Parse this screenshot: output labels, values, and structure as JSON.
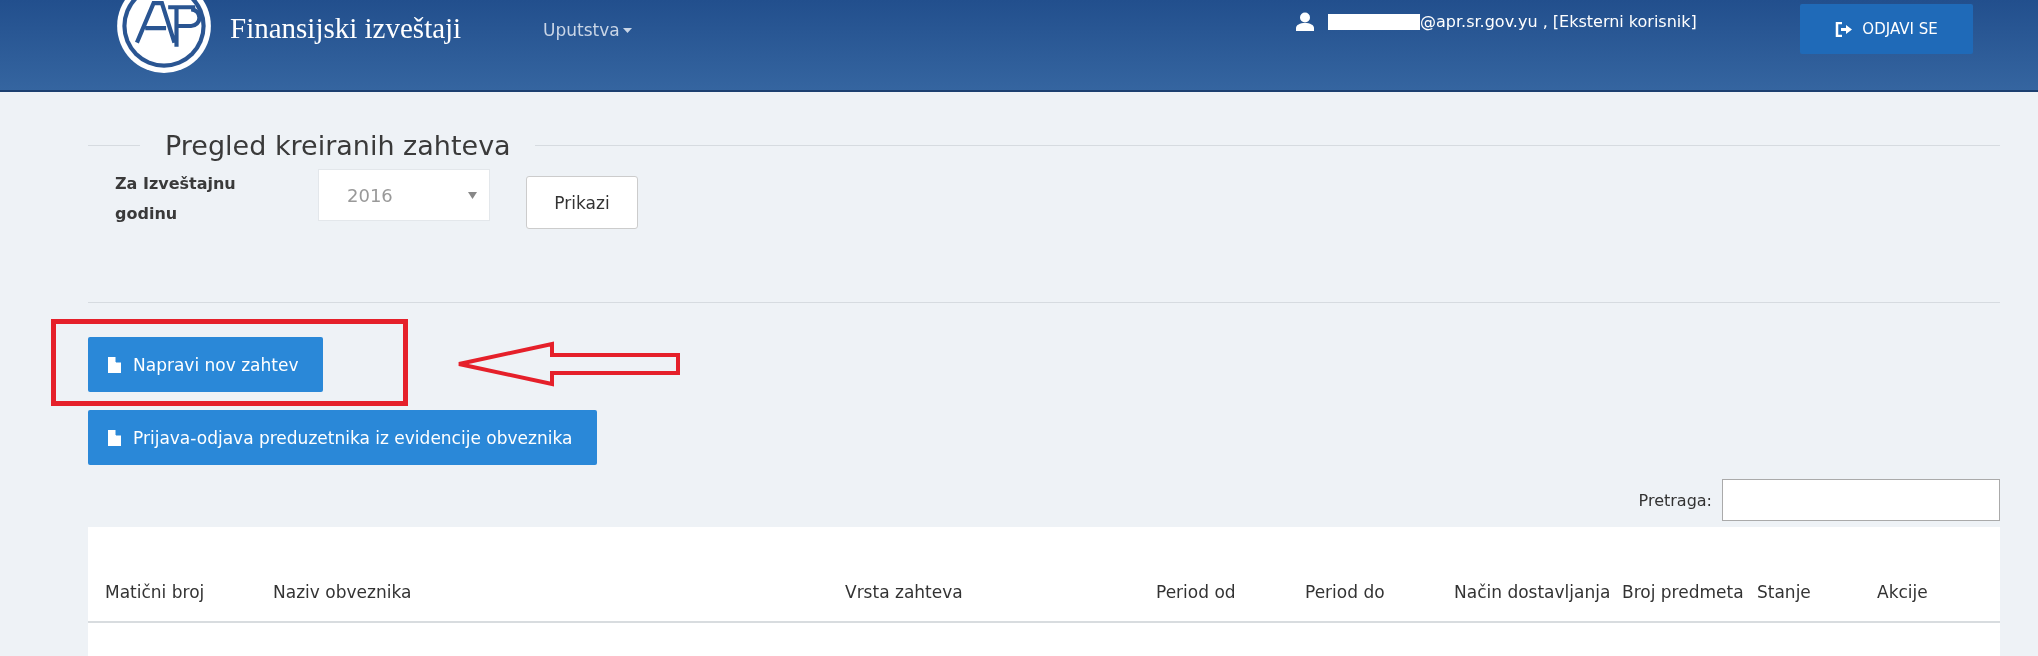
{
  "header": {
    "title": "Finansijski izveštaji",
    "menu": {
      "label": "Uputstva"
    },
    "user": {
      "email": "@apr.sr.gov.yu , [Eksterni korisnik]"
    },
    "logout": {
      "label": "ODJAVI SE"
    }
  },
  "section": {
    "title": "Pregled kreiranih zahteva",
    "year_label": "Za Izveštajnu godinu",
    "year_value": "2016",
    "show_button": "Prikazi"
  },
  "actions": [
    {
      "label": "Napravi nov zahtev",
      "highlighted": true
    },
    {
      "label": "Prijava-odjava preduzetnika iz evidencije obveznika",
      "highlighted": false
    }
  ],
  "search": {
    "label": "Pretraga:"
  },
  "table": {
    "columns": [
      "Matični broj",
      "Naziv obveznika",
      "Vrsta zahteva",
      "Period od",
      "Period do",
      "Način dostavljanja",
      "Broj predmeta",
      "Stanje",
      "Akcije"
    ]
  }
}
